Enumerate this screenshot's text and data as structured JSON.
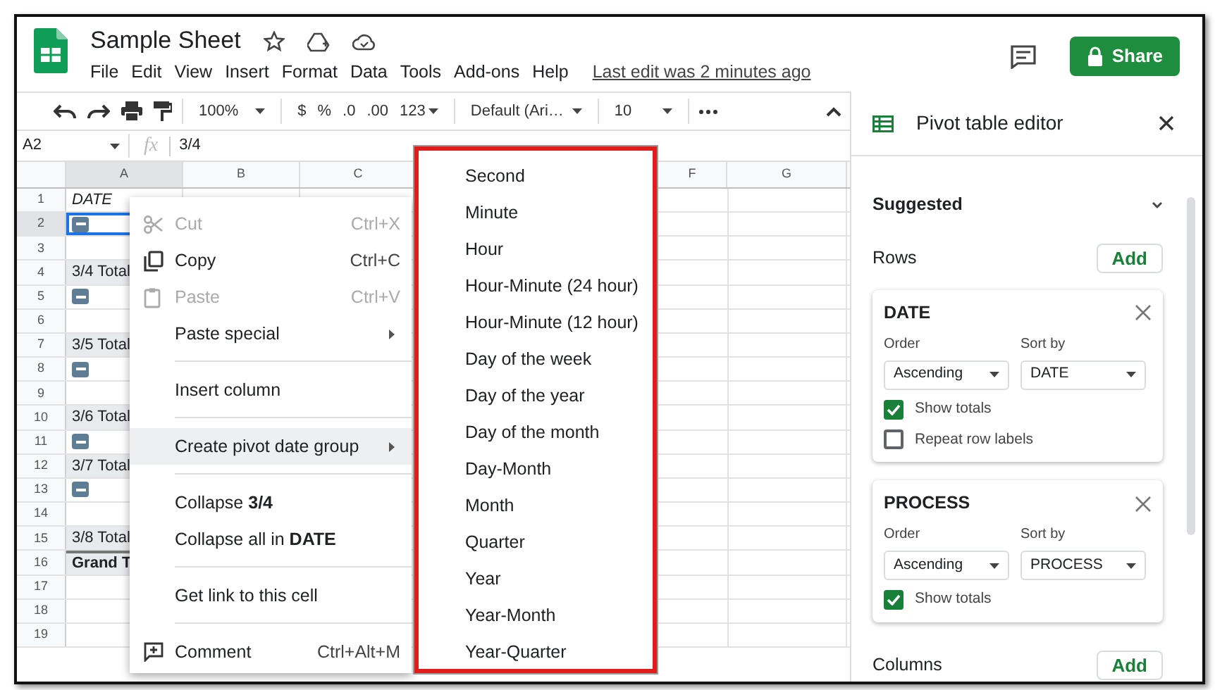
{
  "header": {
    "title": "Sample Sheet",
    "menu": [
      "File",
      "Edit",
      "View",
      "Insert",
      "Format",
      "Data",
      "Tools",
      "Add-ons",
      "Help"
    ],
    "last_edit": "Last edit was 2 minutes ago",
    "share": "Share"
  },
  "toolbar": {
    "zoom": "100%",
    "currency": "$",
    "percent": "%",
    "decrease_decimals": ".0",
    "increase_decimals": ".00",
    "number_format": "123",
    "font": "Default (Ari…",
    "font_size": "10"
  },
  "formula_bar": {
    "cell_ref": "A2",
    "function_label": "fx",
    "value": "3/4"
  },
  "columns": [
    {
      "label": "A",
      "selected": true
    },
    {
      "label": "B",
      "selected": false
    },
    {
      "label": "C",
      "selected": false
    },
    {
      "label": "F",
      "selected": false
    },
    {
      "label": "G",
      "selected": false
    }
  ],
  "rows": [
    {
      "number": "1",
      "kind": "header",
      "cell_a": "DATE",
      "selected": false
    },
    {
      "number": "2",
      "kind": "collapse",
      "selected": true
    },
    {
      "number": "3",
      "kind": "blank",
      "selected": false
    },
    {
      "number": "4",
      "kind": "total",
      "cell_a": "3/4 Total",
      "selected": false
    },
    {
      "number": "5",
      "kind": "collapse",
      "selected": false
    },
    {
      "number": "6",
      "kind": "blank",
      "selected": false
    },
    {
      "number": "7",
      "kind": "total",
      "cell_a": "3/5 Total",
      "selected": false
    },
    {
      "number": "8",
      "kind": "collapse",
      "selected": false
    },
    {
      "number": "9",
      "kind": "blank",
      "selected": false
    },
    {
      "number": "10",
      "kind": "total",
      "cell_a": "3/6 Total",
      "selected": false
    },
    {
      "number": "11",
      "kind": "collapse",
      "selected": false
    },
    {
      "number": "12",
      "kind": "total",
      "cell_a": "3/7 Total",
      "selected": false
    },
    {
      "number": "13",
      "kind": "collapse",
      "selected": false
    },
    {
      "number": "14",
      "kind": "blank",
      "selected": false
    },
    {
      "number": "15",
      "kind": "total",
      "cell_a": "3/8 Total",
      "selected": false
    },
    {
      "number": "16",
      "kind": "grand",
      "cell_a": "Grand T",
      "selected": false
    },
    {
      "number": "17",
      "kind": "blank",
      "selected": false
    },
    {
      "number": "18",
      "kind": "blank",
      "selected": false
    },
    {
      "number": "19",
      "kind": "blank",
      "selected": false
    }
  ],
  "context_menu": [
    {
      "kind": "item",
      "label": "Cut",
      "shortcut": "Ctrl+X",
      "has_icon": true,
      "disabled": true,
      "submenu": false,
      "selected": false
    },
    {
      "kind": "item",
      "label": "Copy",
      "shortcut": "Ctrl+C",
      "has_icon": true,
      "disabled": false,
      "submenu": false,
      "selected": false
    },
    {
      "kind": "item",
      "label": "Paste",
      "shortcut": "Ctrl+V",
      "has_icon": true,
      "disabled": true,
      "submenu": false,
      "selected": false
    },
    {
      "kind": "item",
      "label": "Paste special",
      "has_icon": false,
      "disabled": false,
      "submenu": true,
      "selected": false
    },
    {
      "kind": "divider"
    },
    {
      "kind": "item",
      "label": "Insert column",
      "has_icon": false,
      "disabled": false,
      "submenu": false,
      "selected": false
    },
    {
      "kind": "divider"
    },
    {
      "kind": "item",
      "label": "Create pivot date group",
      "has_icon": false,
      "disabled": false,
      "submenu": true,
      "selected": true
    },
    {
      "kind": "divider"
    },
    {
      "kind": "item",
      "label": "Collapse **3/4**",
      "has_icon": false,
      "disabled": false,
      "submenu": false,
      "selected": false
    },
    {
      "kind": "item",
      "label": "Collapse all in **DATE**",
      "has_icon": false,
      "disabled": false,
      "submenu": false,
      "selected": false
    },
    {
      "kind": "divider"
    },
    {
      "kind": "item",
      "label": "Get link to this cell",
      "has_icon": false,
      "disabled": false,
      "submenu": false,
      "selected": false
    },
    {
      "kind": "divider"
    },
    {
      "kind": "item",
      "label": "Comment",
      "shortcut": "Ctrl+Alt+M",
      "has_icon": true,
      "disabled": false,
      "submenu": false,
      "selected": false
    }
  ],
  "submenu": [
    "Second",
    "Minute",
    "Hour",
    "Hour-Minute (24 hour)",
    "Hour-Minute (12 hour)",
    "Day of the week",
    "Day of the year",
    "Day of the month",
    "Day-Month",
    "Month",
    "Quarter",
    "Year",
    "Year-Month",
    "Year-Quarter"
  ],
  "pivot_editor": {
    "title": "Pivot table editor",
    "suggested": "Suggested",
    "rows_label": "Rows",
    "rows_add": "Add",
    "row_fields": [
      {
        "name": "DATE",
        "order_label": "Order",
        "order": "Ascending",
        "sort_label": "Sort by",
        "sort_by": "DATE",
        "options": [
          {
            "label": "Show totals",
            "checked": true
          },
          {
            "label": "Repeat row labels",
            "checked": false
          }
        ]
      },
      {
        "name": "PROCESS",
        "order_label": "Order",
        "order": "Ascending",
        "sort_label": "Sort by",
        "sort_by": "PROCESS",
        "options": [
          {
            "label": "Show totals",
            "checked": true
          }
        ]
      }
    ],
    "columns_label": "Columns",
    "columns_add": "Add"
  }
}
